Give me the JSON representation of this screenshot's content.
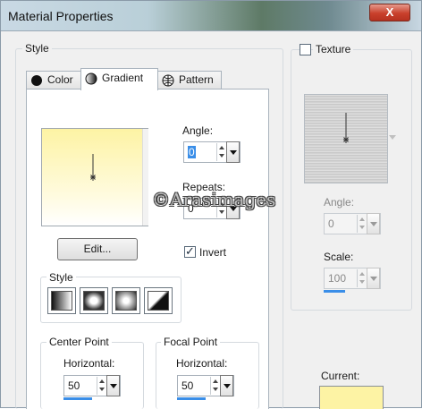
{
  "window": {
    "title": "Material Properties",
    "close_label": "X"
  },
  "style_group": {
    "label": "Style"
  },
  "tabs": [
    {
      "label": "Color",
      "icon": "color-icon"
    },
    {
      "label": "Gradient",
      "icon": "gradient-icon",
      "active": true
    },
    {
      "label": "Pattern",
      "icon": "pattern-icon"
    }
  ],
  "gradient": {
    "angle_label": "Angle:",
    "angle_value": "0",
    "repeats_label": "Repeats:",
    "repeats_value": "0",
    "edit_label": "Edit...",
    "invert_label": "Invert",
    "invert_checked": true,
    "style_label": "Style",
    "style_options": [
      "linear-gradient-icon",
      "rectangular-gradient-icon",
      "sunburst-gradient-icon",
      "radial-gradient-icon"
    ],
    "colors": {
      "top": "#fdf3a4",
      "bottom": "#ffffff"
    }
  },
  "center_point": {
    "label": "Center Point",
    "horizontal_label": "Horizontal:",
    "horizontal_value": "50"
  },
  "focal_point": {
    "label": "Focal Point",
    "horizontal_label": "Horizontal:",
    "horizontal_value": "50"
  },
  "texture": {
    "label": "Texture",
    "checked": false,
    "angle_label": "Angle:",
    "angle_value": "0",
    "scale_label": "Scale:",
    "scale_value": "100"
  },
  "current": {
    "label": "Current:",
    "color": "#fdf3a4"
  },
  "watermark": "©Arasimages"
}
